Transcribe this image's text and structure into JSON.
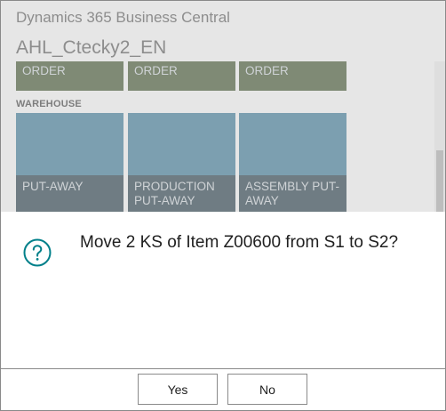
{
  "header": {
    "app_title": "Dynamics 365 Business Central",
    "company": "AHL_Ctecky2_EN"
  },
  "tiles_top": [
    {
      "label": "ORDER"
    },
    {
      "label": "ORDER"
    },
    {
      "label": "ORDER"
    }
  ],
  "warehouse": {
    "section_label": "WAREHOUSE",
    "tiles": [
      {
        "label": "PUT-AWAY"
      },
      {
        "label": "PRODUCTION PUT-AWAY"
      },
      {
        "label": "ASSEMBLY PUT-AWAY"
      }
    ]
  },
  "dialog": {
    "icon": "question-icon",
    "message": "Move 2 KS of Item Z00600 from S1 to S2?",
    "yes_label": "Yes",
    "no_label": "No"
  },
  "colors": {
    "dim_background": "#e6e6e6",
    "tile_green": "#7f8a75",
    "tile_blue": "#7c9fb0",
    "tile_band": "#6f7c83",
    "accent_teal": "#00808a"
  }
}
